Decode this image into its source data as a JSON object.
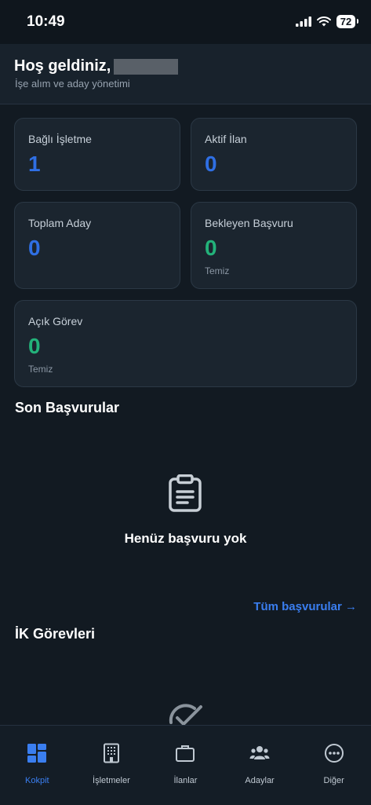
{
  "status_bar": {
    "time": "10:49",
    "battery": "72"
  },
  "header": {
    "greeting": "Hoş geldiniz,",
    "subtitle": "İşe alım ve aday yönetimi"
  },
  "stats": [
    {
      "label": "Bağlı İşletme",
      "value": "1",
      "color": "#2f6fe4"
    },
    {
      "label": "Aktif İlan",
      "value": "0",
      "color": "#2f6fe4"
    },
    {
      "label": "Toplam Aday",
      "value": "0",
      "color": "#2f6fe4"
    },
    {
      "label": "Bekleyen Başvuru",
      "value": "0",
      "note": "Temiz",
      "color": "#23b27a"
    },
    {
      "label": "Açık Görev",
      "value": "0",
      "note": "Temiz",
      "color": "#23b27a"
    }
  ],
  "recent_applications": {
    "title": "Son Başvurular",
    "empty_icon": "clipboard-icon",
    "empty_text": "Henüz başvuru yok",
    "all_link": "Tüm başvurular →"
  },
  "hr_tasks": {
    "title": "İK Görevleri",
    "icon": "check-circle-icon"
  },
  "tab_bar": [
    {
      "label": "Kokpit",
      "icon": "dashboard-icon",
      "active": true
    },
    {
      "label": "İşletmeler",
      "icon": "building-icon",
      "active": false
    },
    {
      "label": "İlanlar",
      "icon": "briefcase-icon",
      "active": false
    },
    {
      "label": "Adaylar",
      "icon": "people-icon",
      "active": false
    },
    {
      "label": "Diğer",
      "icon": "more-icon",
      "active": false
    }
  ],
  "colors": {
    "background": "#121a22",
    "card": "#1b252f",
    "accent_blue": "#2f6fe4",
    "accent_green": "#23b27a",
    "link": "#3a7ef0"
  }
}
